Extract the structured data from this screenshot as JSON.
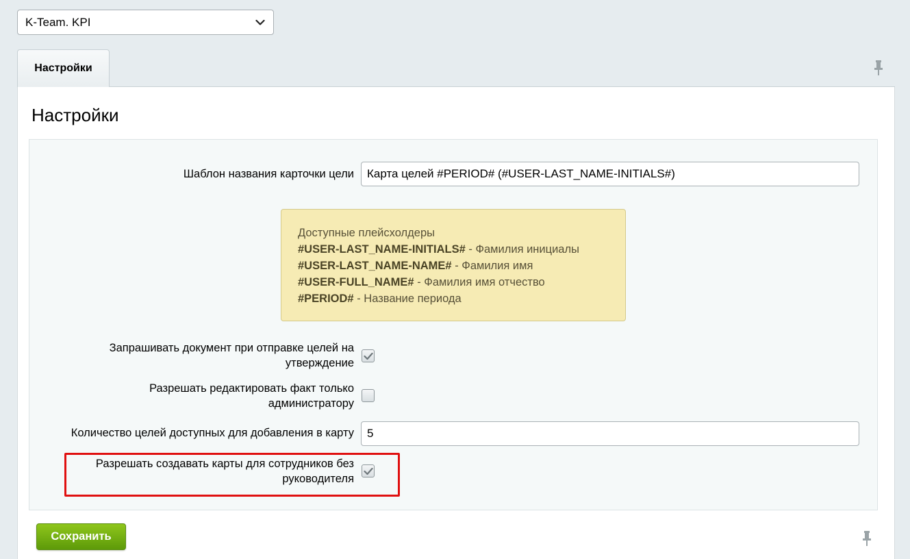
{
  "site_select": {
    "value": "K-Team. KPI"
  },
  "tabs": [
    {
      "label": "Настройки"
    }
  ],
  "panel": {
    "title": "Настройки"
  },
  "form": {
    "template_label": "Шаблон названия карточки цели",
    "template_value": "Карта целей #PERIOD# (#USER-LAST_NAME-INITIALS#)",
    "placeholders": {
      "title": "Доступные плейсхолдеры",
      "items": [
        {
          "code": "#USER-LAST_NAME-INITIALS#",
          "desc": " - Фамилия инициалы"
        },
        {
          "code": "#USER-LAST_NAME-NAME#",
          "desc": " - Фамилия имя"
        },
        {
          "code": "#USER-FULL_NAME#",
          "desc": " - Фамилия имя отчество"
        },
        {
          "code": "#PERIOD#",
          "desc": " - Название периода"
        }
      ]
    },
    "request_doc_label_1": "Запрашивать документ при отправке целей на",
    "request_doc_label_2": "утверждение",
    "request_doc_checked": true,
    "edit_fact_label_1": "Разрешать редактировать факт только",
    "edit_fact_label_2": "администратору",
    "edit_fact_checked": false,
    "goals_count_label": "Количество целей доступных для добавления в карту",
    "goals_count_value": "5",
    "no_manager_label_1": "Разрешать создавать карты для сотрудников без",
    "no_manager_label_2": "руководителя",
    "no_manager_checked": true
  },
  "save_button": {
    "label": "Сохранить"
  },
  "colors": {
    "save": "#6fae10",
    "highlight": "#e01010",
    "hint_bg": "#f6ebb4"
  },
  "icons": {
    "pin": "pin-icon",
    "chevron": "chevron-down-icon",
    "check": "checkmark-icon"
  }
}
